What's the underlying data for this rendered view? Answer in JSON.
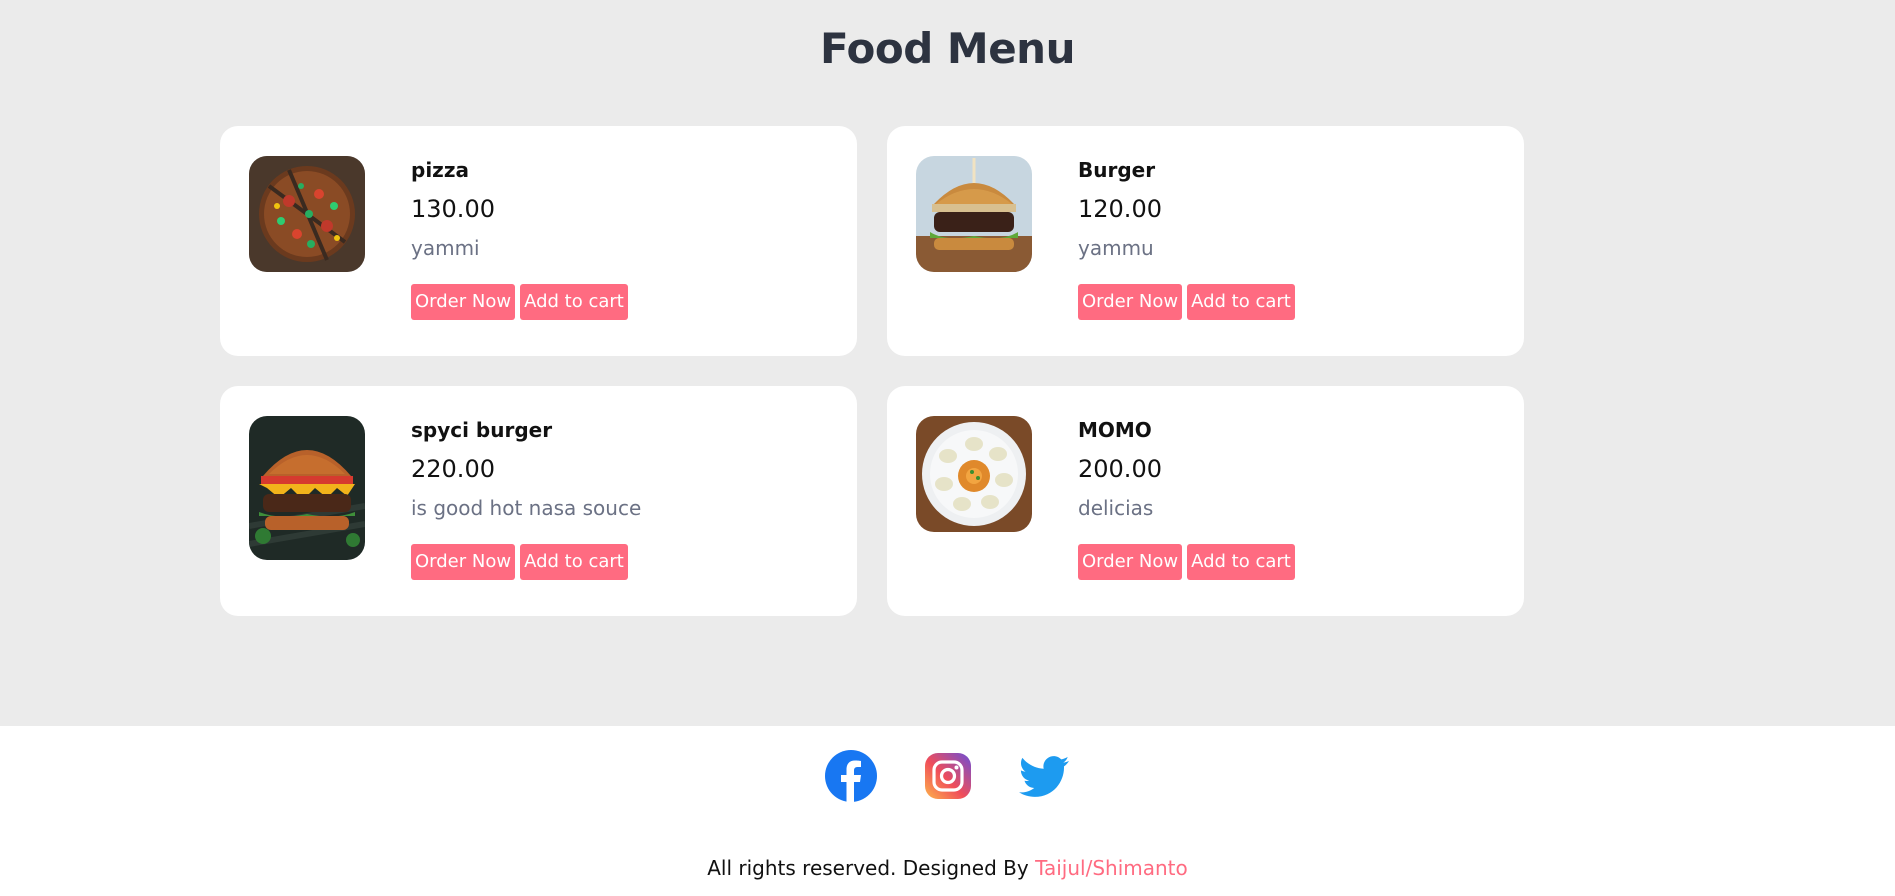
{
  "page": {
    "title": "Food Menu"
  },
  "menu": {
    "items": [
      {
        "name": "pizza",
        "price": "130.00",
        "description": "yammi",
        "image": "pizza-image",
        "order_label": "Order Now",
        "cart_label": "Add to cart"
      },
      {
        "name": "Burger",
        "price": "120.00",
        "description": "yammu",
        "image": "burger-image",
        "order_label": "Order Now",
        "cart_label": "Add to cart"
      },
      {
        "name": "spyci burger",
        "price": "220.00",
        "description": "is good hot nasa souce",
        "image": "spicy-burger-image",
        "order_label": "Order Now",
        "cart_label": "Add to cart"
      },
      {
        "name": "MOMO",
        "price": "200.00",
        "description": "delicias",
        "image": "momo-image",
        "order_label": "Order Now",
        "cart_label": "Add to cart"
      }
    ]
  },
  "footer": {
    "social": [
      "facebook-icon",
      "instagram-icon",
      "twitter-icon"
    ],
    "copyright_text": "All rights reserved. Designed By ",
    "designer": "Taijul/Shimanto"
  },
  "colors": {
    "accent": "#ff6b81",
    "background": "#ebebeb",
    "card": "#ffffff",
    "title": "#2d3340",
    "description": "#6b7184",
    "facebook": "#1877f2",
    "twitter": "#1d9bf0"
  }
}
